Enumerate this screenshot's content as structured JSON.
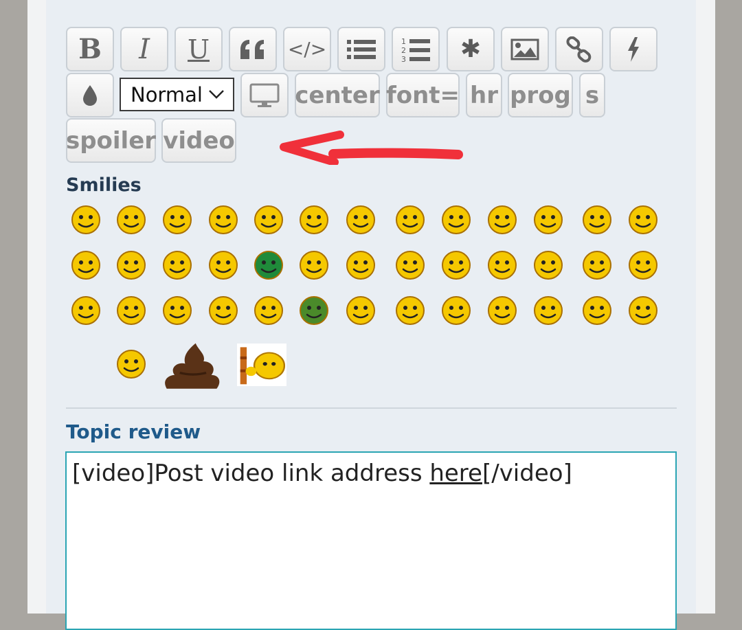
{
  "toolbar": {
    "row1": [
      {
        "name": "bold-button",
        "icon": "bold-icon",
        "label": "B"
      },
      {
        "name": "italic-button",
        "icon": "italic-icon",
        "label": "I"
      },
      {
        "name": "underline-button",
        "icon": "underline-icon",
        "label": "U"
      },
      {
        "name": "quote-button",
        "icon": "quote-icon"
      },
      {
        "name": "code-button",
        "icon": "code-icon",
        "label": "</>"
      },
      {
        "name": "bullet-list-button",
        "icon": "list-icon"
      },
      {
        "name": "numbered-list-button",
        "icon": "numbered-list-icon"
      },
      {
        "name": "list-item-button",
        "icon": "asterisk-icon",
        "label": "✱"
      },
      {
        "name": "image-button",
        "icon": "image-icon"
      },
      {
        "name": "link-button",
        "icon": "link-icon"
      },
      {
        "name": "flash-button",
        "icon": "flash-icon"
      }
    ],
    "color_button_icon": "droplet-icon",
    "font_size": {
      "selected": "Normal"
    },
    "monitor_button_icon": "monitor-icon",
    "text_buttons_row2": [
      "center",
      "font=",
      "hr",
      "prog",
      "s"
    ],
    "text_buttons_row3": [
      "spoiler",
      "video"
    ],
    "annotation": "red-arrow-pointing-at-video"
  },
  "smilies": {
    "title": "Smilies",
    "items": [
      "big-grin",
      "arrow",
      "cool",
      "confused-frown",
      "neutral-grin",
      "worried",
      "geek",
      "wink",
      "surprised",
      "sad",
      "nerd-beard",
      "rolling-eyes",
      "evil",
      "exclamation",
      "idea",
      "laughing",
      "angry-grin",
      "green-grin",
      "question",
      "shocked",
      "eyes-up",
      "twisted-evil",
      "innocent",
      "razz",
      "crying",
      "eyeroll",
      "thinking",
      "mrgreen-neutral",
      "smug",
      "silent-finger",
      "blank-stare",
      "sick",
      "tied-mouth",
      "mad-shhh",
      "thumbs-down",
      "thumbs-up",
      "straight",
      "waving",
      "glasses-nerd",
      "pensive",
      "poop",
      "bang-head"
    ]
  },
  "review": {
    "title": "Topic review",
    "text_before": "[video]Post video link address ",
    "text_link": "here",
    "text_after": "[/video]"
  },
  "colors": {
    "accent": "#1f5a8a",
    "textarea_border": "#2aa5b3",
    "arrow": "#f0303a",
    "smiley_yellow": "#f5c800"
  }
}
